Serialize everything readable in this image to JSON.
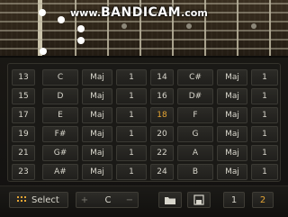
{
  "watermark": {
    "prefix": "www.",
    "main": "BANDICAM",
    "suffix": ".com"
  },
  "rows": [
    [
      {
        "num": "13",
        "note": "C",
        "type": "Maj",
        "val": "1"
      },
      {
        "num": "14",
        "note": "C#",
        "type": "Maj",
        "val": "1"
      }
    ],
    [
      {
        "num": "15",
        "note": "D",
        "type": "Maj",
        "val": "1"
      },
      {
        "num": "16",
        "note": "D#",
        "type": "Maj",
        "val": "1"
      }
    ],
    [
      {
        "num": "17",
        "note": "E",
        "type": "Maj",
        "val": "1"
      },
      {
        "num": "18",
        "note": "F",
        "type": "Maj",
        "val": "1"
      }
    ],
    [
      {
        "num": "19",
        "note": "F#",
        "type": "Maj",
        "val": "1"
      },
      {
        "num": "20",
        "note": "G",
        "type": "Maj",
        "val": "1"
      }
    ],
    [
      {
        "num": "21",
        "note": "G#",
        "type": "Maj",
        "val": "1"
      },
      {
        "num": "22",
        "note": "A",
        "type": "Maj",
        "val": "1"
      }
    ],
    [
      {
        "num": "23",
        "note": "A#",
        "type": "Maj",
        "val": "1"
      },
      {
        "num": "24",
        "note": "B",
        "type": "Maj",
        "val": "1"
      }
    ]
  ],
  "active_slot": "18",
  "toolbar": {
    "select_label": "Select",
    "select_icon": "grid-dots-icon",
    "key_plus": "+",
    "key_value": "C",
    "key_minus": "−",
    "folder_icon": "folder-icon",
    "save_icon": "save-icon",
    "page_buttons": [
      "1",
      "2"
    ],
    "active_page": "2"
  },
  "colors": {
    "accent": "#e5a534",
    "text": "#d8d6cc",
    "background": "#16140f"
  }
}
